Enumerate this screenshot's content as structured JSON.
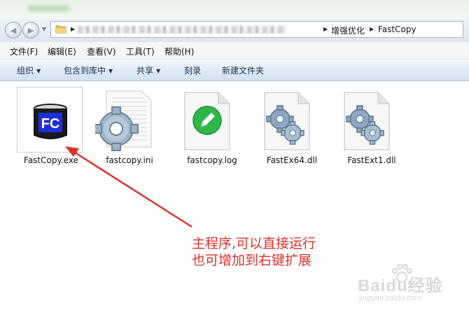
{
  "address_bar": {
    "crumbs": [
      "增强优化",
      "FastCopy"
    ]
  },
  "menu": {
    "items": [
      "文件(F)",
      "编辑(E)",
      "查看(V)",
      "工具(T)",
      "帮助(H)"
    ]
  },
  "commands": {
    "organize": "组织",
    "include_in_library": "包含到库中",
    "share": "共享",
    "burn": "刻录",
    "new_folder": "新建文件夹"
  },
  "files": [
    {
      "name": "FastCopy.exe",
      "icon": "fastcopy-exe-icon",
      "selected": true
    },
    {
      "name": "fastcopy.ini",
      "icon": "ini-settings-icon"
    },
    {
      "name": "fastcopy.log",
      "icon": "log-pencil-icon"
    },
    {
      "name": "FastEx64.dll",
      "icon": "dll-gears-icon"
    },
    {
      "name": "FastExt1.dll",
      "icon": "dll-gears-icon"
    }
  ],
  "annotation": {
    "line1": "主程序,可以直接运行",
    "line2": "也可增加到右键扩展",
    "color": "#e0312c"
  },
  "watermark": {
    "brand": "Baidu经验",
    "url": "jingyan.baidu.com"
  }
}
